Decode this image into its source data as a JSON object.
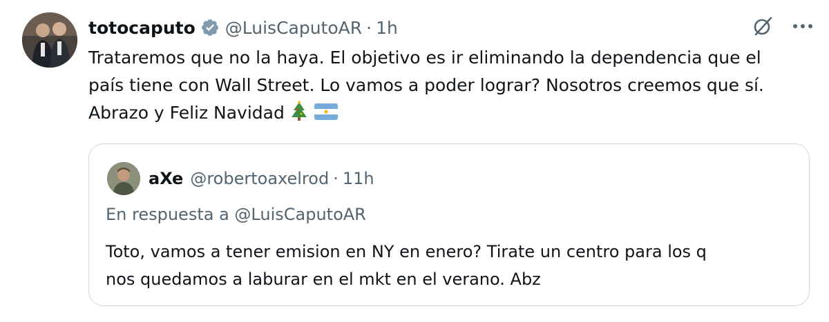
{
  "tweet": {
    "author_name": "totocaputo",
    "author_handle": "@LuisCaputoAR",
    "separator": "·",
    "time": "1h",
    "text_lines": [
      "Trataremos que no la haya. El objetivo es ir eliminando la dependencia que el",
      "país tiene con Wall Street. Lo vamos a poder lograr? Nosotros creemos que sí.",
      "Abrazo y Feliz Navidad"
    ],
    "emoji": [
      "christmas-tree",
      "argentina-flag"
    ],
    "icons": [
      "verified-badge-icon",
      "grok-icon",
      "more-icon"
    ]
  },
  "quoted": {
    "author_name": "aXe",
    "author_handle": "@robertoaxelrod",
    "separator": "·",
    "time": "11h",
    "reply_to": "En respuesta a @LuisCaputoAR",
    "text_lines": [
      "Toto, vamos a tener emision en NY en enero? Tirate un centro para los q",
      "nos quedamos a laburar en el mkt en el verano. Abz"
    ]
  },
  "colors": {
    "text": "#0f1419",
    "secondary": "#536471",
    "verified_badge": "#829aab",
    "border": "#cfd9de"
  }
}
